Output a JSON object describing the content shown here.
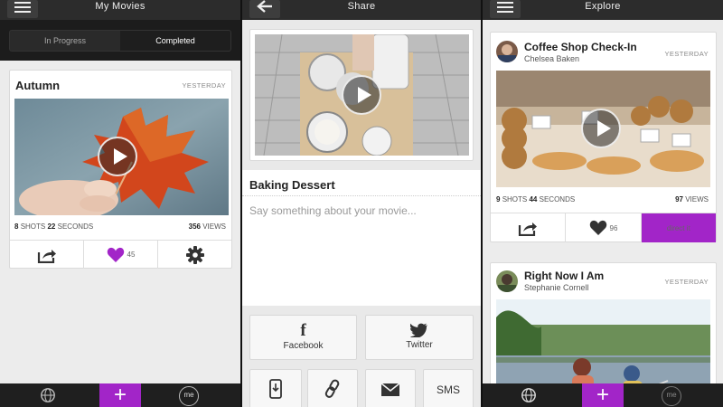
{
  "screen1": {
    "title": "My Movies",
    "tabs": [
      {
        "label": "In Progress",
        "active": false
      },
      {
        "label": "Completed",
        "active": true
      }
    ],
    "card": {
      "title": "Autumn",
      "date": "YESTERDAY",
      "shots": "8",
      "shots_label": "SHOTS",
      "seconds": "22",
      "seconds_label": "SECONDS",
      "views": "356",
      "views_label": "VIEWS",
      "likes": "45"
    }
  },
  "screen2": {
    "title": "Share",
    "movie_title": "Baking Dessert",
    "message_placeholder": "Say something about your movie...",
    "facebook_label": "Facebook",
    "twitter_label": "Twitter",
    "sms_label": "SMS"
  },
  "screen3": {
    "title": "Explore",
    "cards": [
      {
        "title": "Coffee Shop Check-In",
        "author": "Chelsea Baken",
        "date": "YESTERDAY",
        "shots": "9",
        "seconds": "44",
        "views": "97",
        "likes": "96",
        "action_label": "direct it"
      },
      {
        "title": "Right Now I Am",
        "author": "Stephanie Cornell",
        "date": "YESTERDAY"
      }
    ],
    "labels": {
      "shots": "SHOTS",
      "seconds": "SECONDS",
      "views": "VIEWS"
    }
  },
  "nav": {
    "me_label": "me"
  },
  "colors": {
    "accent": "#a225c8",
    "topbar": "#2c2c2c"
  }
}
